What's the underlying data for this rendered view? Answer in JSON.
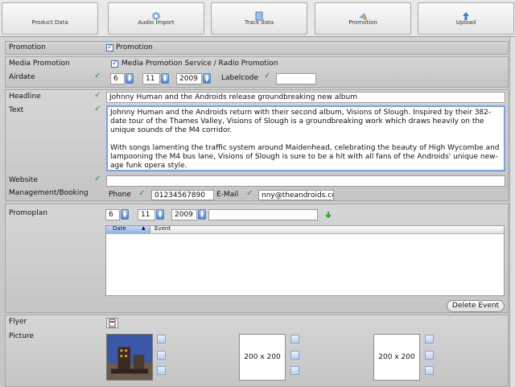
{
  "toolbar": {
    "tabs": [
      {
        "label": "Product Data",
        "icon": "product-data-icon"
      },
      {
        "label": "Audio Import",
        "icon": "audio-import-icon"
      },
      {
        "label": "Track data",
        "icon": "track-data-icon"
      },
      {
        "label": "Promotion",
        "icon": "promotion-icon"
      },
      {
        "label": "Upload",
        "icon": "upload-icon"
      }
    ]
  },
  "promotion": {
    "label": "Promotion",
    "checkbox_label": "Promotion",
    "checked": true
  },
  "media": {
    "label": "Media Promotion",
    "checkbox_label": "Media Promotion Service / Radio Promotion",
    "checked": true,
    "airdate_label": "Airdate",
    "day": "6",
    "month": "11",
    "year": "2009",
    "labelcode_label": "Labelcode",
    "labelcode_value": ""
  },
  "content": {
    "headline_label": "Headline",
    "headline_value": "Johnny Human and the Androids release groundbreaking new album",
    "text_label": "Text",
    "text_value": "Johnny Human and the Androids return with their second album, Visions of Slough. Inspired by their 382-date tour of the Thames Valley, Visions of Slough is a groundbreaking work which draws heavily on the unique sounds of the M4 corridor.\n\nWith songs lamenting the traffic system around Maidenhead, celebrating the beauty of High Wycombe and lampooning the M4 bus lane, Visions of Slough is sure to be a hit with all fans of the Androids' unique new-age funk opera style.",
    "website_label": "Website",
    "website_value": "",
    "management_label": "Management/Booking",
    "phone_label": "Phone",
    "phone_value": "01234567890",
    "email_label": "E-Mail",
    "email_value": "nny@theandroids.com"
  },
  "promoplan": {
    "label": "Promoplan",
    "day": "6",
    "month": "11",
    "year": "2009",
    "event_value": "",
    "columns": [
      "Date",
      "Event"
    ],
    "delete_label": "Delete Event"
  },
  "media_assets": {
    "flyer_label": "Flyer",
    "picture_label": "Picture",
    "placeholder_1": "200 x 200",
    "placeholder_2": "200 x 200"
  },
  "colors": {
    "check": "#1f9a1f",
    "accent": "#4d7fd0"
  }
}
